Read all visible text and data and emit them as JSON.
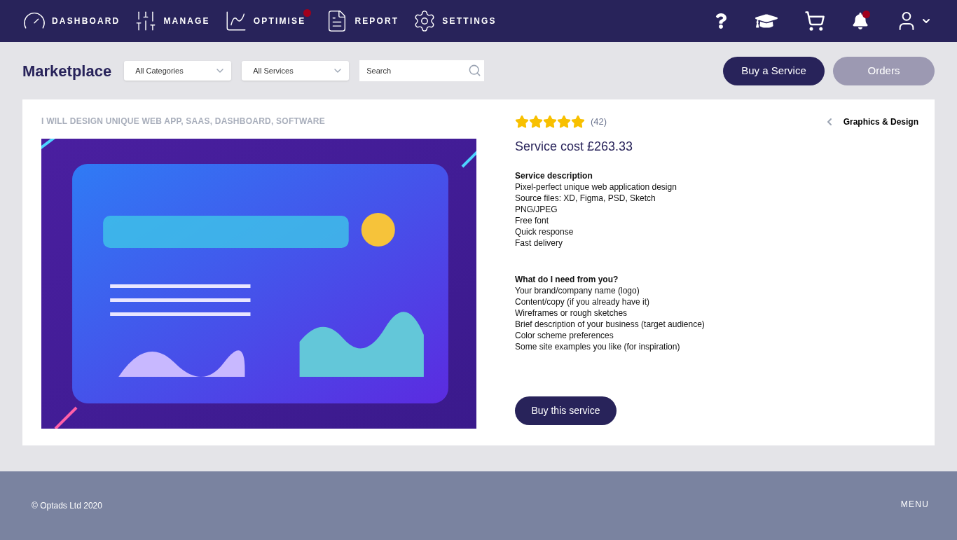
{
  "nav": {
    "items": [
      {
        "label": "DASHBOARD",
        "badge": false
      },
      {
        "label": "MANAGE",
        "badge": false
      },
      {
        "label": "OPTIMISE",
        "badge": true
      },
      {
        "label": "REPORT",
        "badge": false
      },
      {
        "label": "SETTINGS",
        "badge": false
      }
    ],
    "notifications_badge": true
  },
  "toolbar": {
    "title": "Marketplace",
    "selects": [
      {
        "value": "All Categories"
      },
      {
        "value": "All Services"
      }
    ],
    "search": {
      "placeholder": "Search"
    },
    "buttons": [
      {
        "label": "Buy a Service",
        "kind": "primary"
      },
      {
        "label": "Orders",
        "kind": "secondary"
      }
    ]
  },
  "listing": {
    "title": "I WILL DESIGN UNIQUE WEB APP, SAAS, DASHBOARD, SOFTWARE",
    "stars": 5,
    "reviews": "(42)",
    "category": "Graphics & Design",
    "cost": "Service cost £263.33",
    "sections": [
      {
        "heading": "Service description",
        "lines": [
          "Pixel-perfect unique web application design",
          "Source files: XD, Figma, PSD, Sketch",
          "PNG/JPEG",
          "Free font",
          "Quick response",
          "Fast delivery"
        ]
      },
      {
        "heading": "What do I need from you?",
        "lines": [
          "Your brand/company name (logo)",
          "Content/copy (if you already have it)",
          "Wireframes or rough sketches",
          "Brief description of your business (target audience)",
          "Color scheme preferences",
          "Some site examples you like (for inspiration)"
        ]
      }
    ],
    "action": "Buy this service"
  },
  "footer": {
    "copyright": "© Optads Ltd 2020",
    "menu": "MENU"
  }
}
